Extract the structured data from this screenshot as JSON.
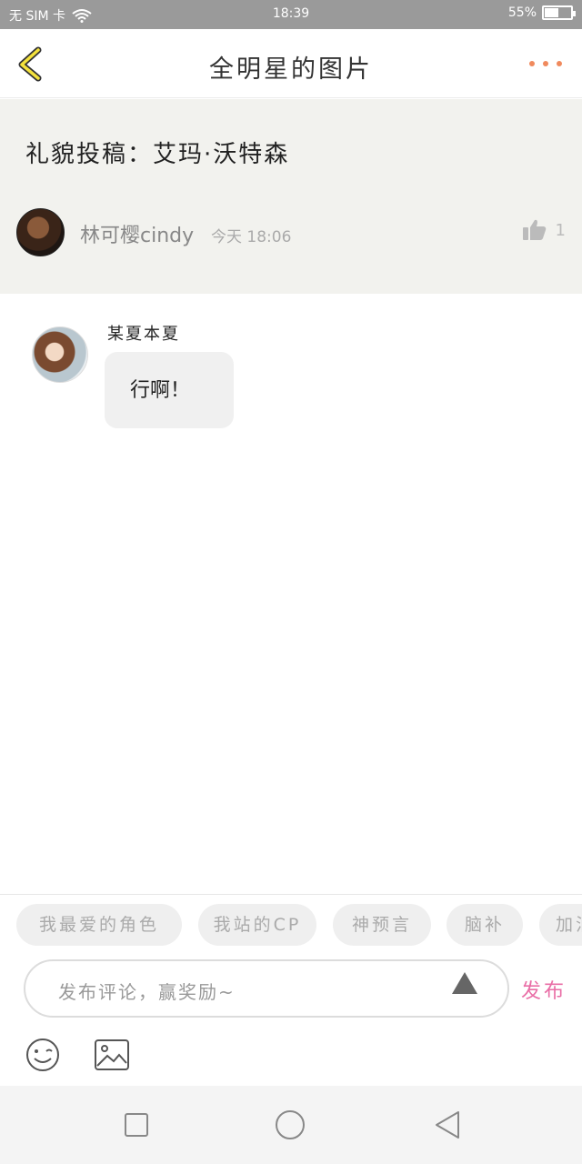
{
  "status_bar": {
    "carrier": "无 SIM 卡",
    "time": "18:39",
    "battery_text": "55%",
    "battery_level": 0.55
  },
  "nav": {
    "title": "全明星的图片",
    "back_icon": "chevron-left-icon",
    "more_icon": "more-dots-icon",
    "accent_color": "#f08a5d"
  },
  "post": {
    "title": "礼貌投稿：艾玛·沃特森",
    "author": "林可樱cindy",
    "time": "今天 18:06",
    "likes": "1"
  },
  "comments": [
    {
      "user": "某夏本夏",
      "text": "行啊！"
    }
  ],
  "quick_tags": [
    "我最爱的角色",
    "我站的CP",
    "神预言",
    "脑补",
    "加油"
  ],
  "composer": {
    "placeholder": "发布评论，赢奖励~",
    "publish_label": "发布",
    "publish_color": "#e96ea6"
  },
  "tools": {
    "emoji_icon": "emoji-icon",
    "image_icon": "image-icon"
  },
  "system_nav": {
    "buttons": [
      "recent-apps-icon",
      "home-icon",
      "back-triangle-icon"
    ]
  }
}
